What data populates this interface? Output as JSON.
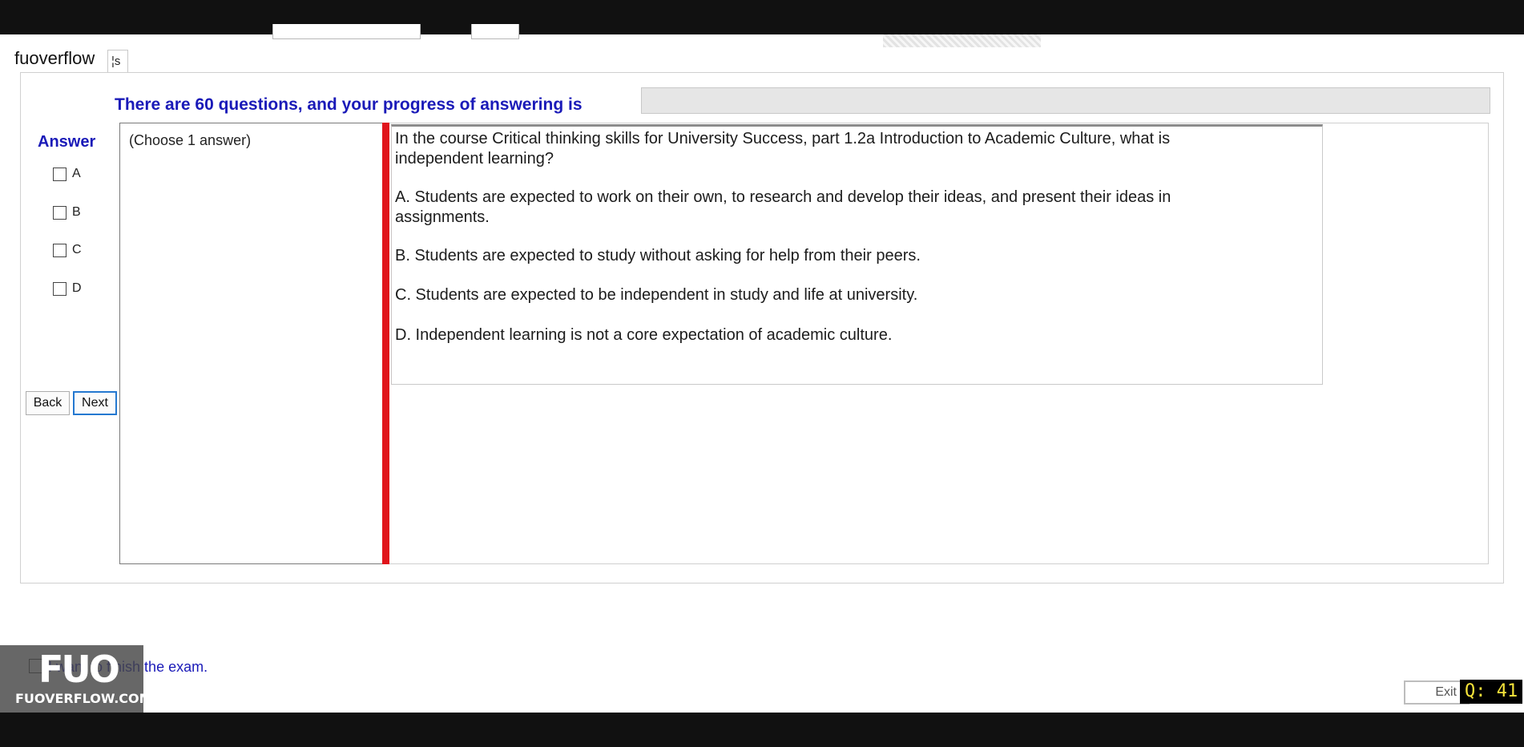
{
  "brand": "fuoverflow",
  "tab_label": "¦s",
  "progress": {
    "label": "There are 60 questions, and your progress of answering is",
    "value": 0
  },
  "answer_panel": {
    "title": "Answer",
    "options": [
      "A",
      "B",
      "C",
      "D"
    ]
  },
  "navigation": {
    "back": "Back",
    "next": "Next"
  },
  "choose_hint": "(Choose 1 answer)",
  "question": {
    "text": "In the course Critical thinking skills for University Success, part 1.2a Introduction to Academic Culture, what is independent learning?",
    "choices": [
      "A.  Students are expected to work on their own, to research and develop their ideas, and present their ideas in assignments.",
      "B.  Students are expected to study without asking for help from their peers.",
      "C.  Students are expected to be independent in study and life at university.",
      "D.  Independent learning is not a core expectation of academic culture."
    ]
  },
  "finish_label": "I want to finish the exam.",
  "watermark": {
    "mark": "FUO",
    "url": "FUOVERFLOW.COM"
  },
  "exit_label": "Exit",
  "question_counter": "Q: 41",
  "colors": {
    "accent_blue": "#1a1ab8",
    "divider_red": "#e0141b",
    "counter_yellow": "#f5e33a"
  }
}
